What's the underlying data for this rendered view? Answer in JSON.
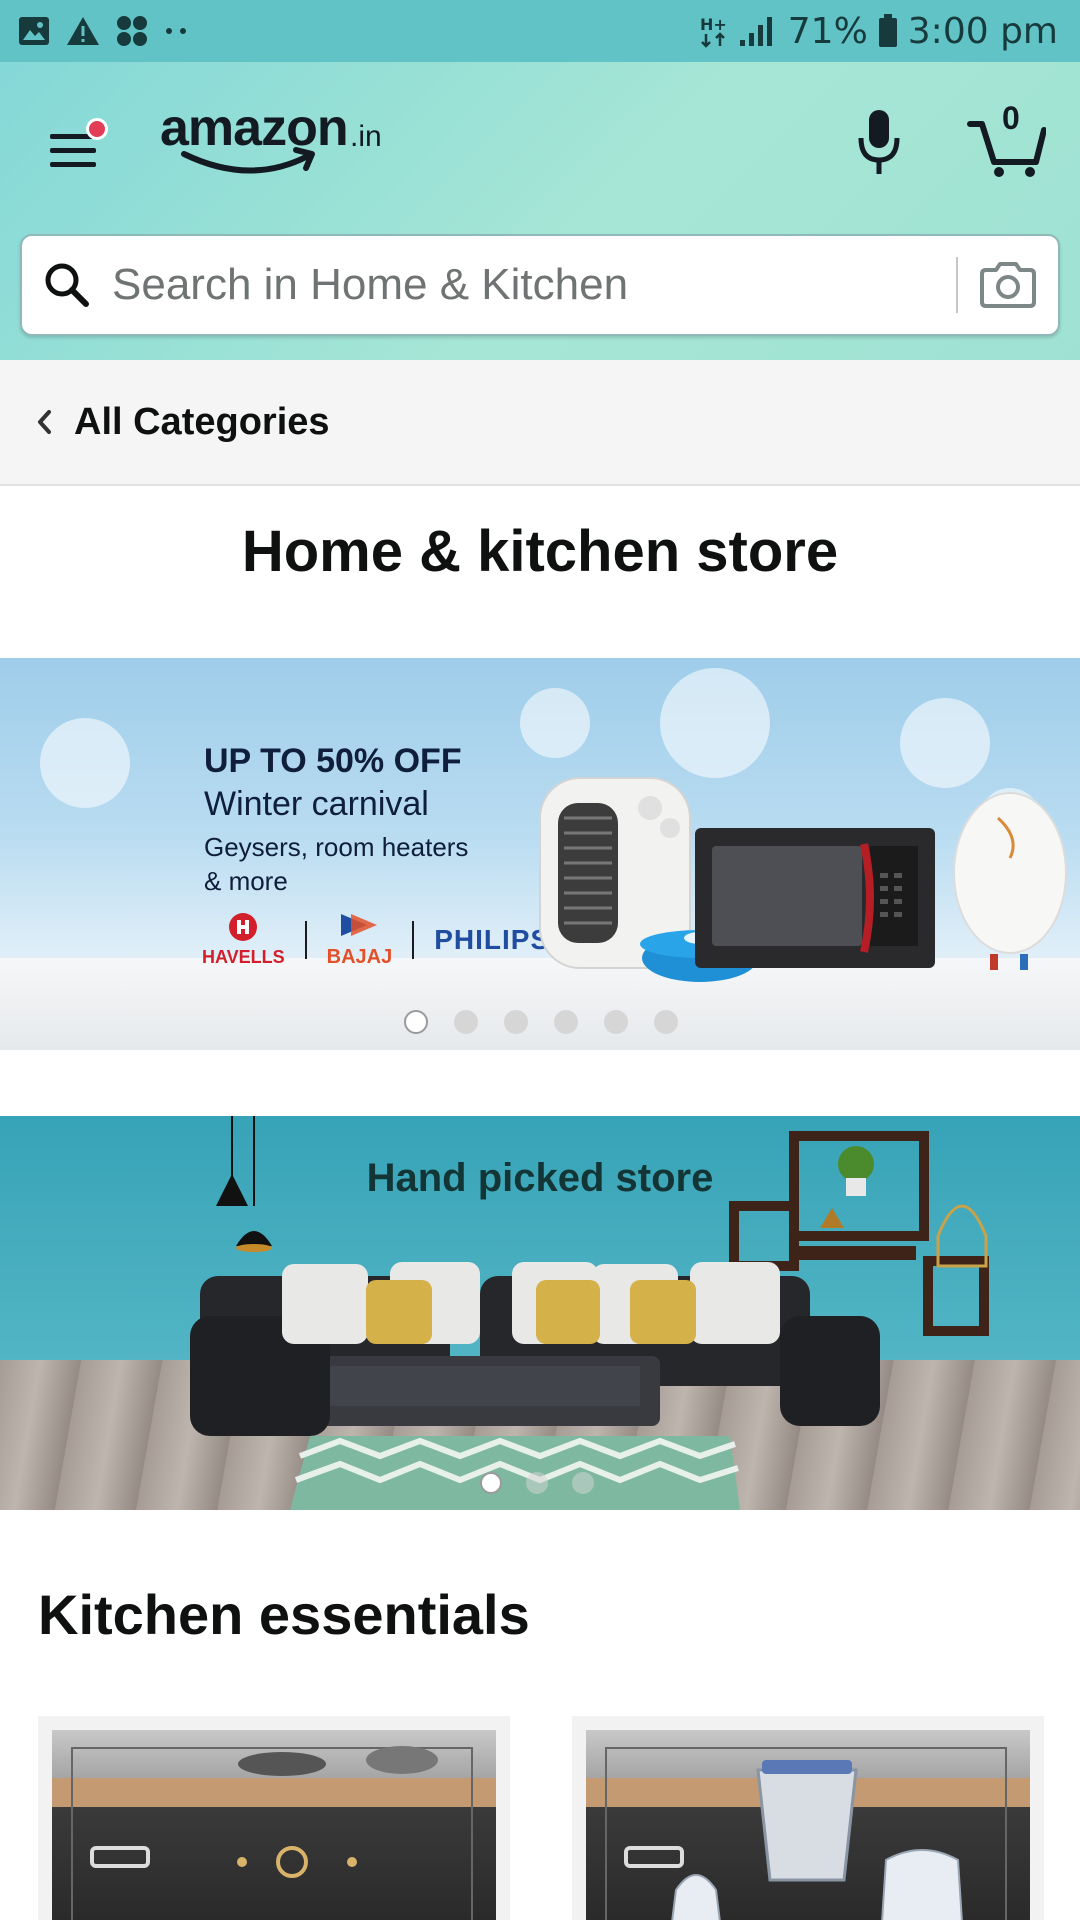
{
  "status_bar": {
    "battery_percent": "71%",
    "time": "3:00 pm",
    "network": "H+"
  },
  "header": {
    "logo_text": "amazon",
    "logo_suffix": ".in",
    "cart_count": "0"
  },
  "search": {
    "placeholder": "Search in Home & Kitchen"
  },
  "breadcrumb": {
    "label": "All Categories"
  },
  "page": {
    "title": "Home & kitchen store"
  },
  "banner_1": {
    "headline": "UP TO 50% OFF",
    "subtitle": "Winter carnival",
    "detail_line1": "Geysers, room heaters",
    "detail_line2": "& more",
    "brands": [
      "HAVELLS",
      "BAJAJ",
      "PHILIPS"
    ],
    "slide_count": 6,
    "active_slide": 1
  },
  "banner_2": {
    "title": "Hand picked store",
    "slide_count": 3,
    "active_slide": 1
  },
  "section": {
    "title": "Kitchen essentials"
  },
  "colors": {
    "header_teal": "#9fe2d3",
    "status_bar": "#62c3c6",
    "notification_dot": "#e23e57"
  }
}
